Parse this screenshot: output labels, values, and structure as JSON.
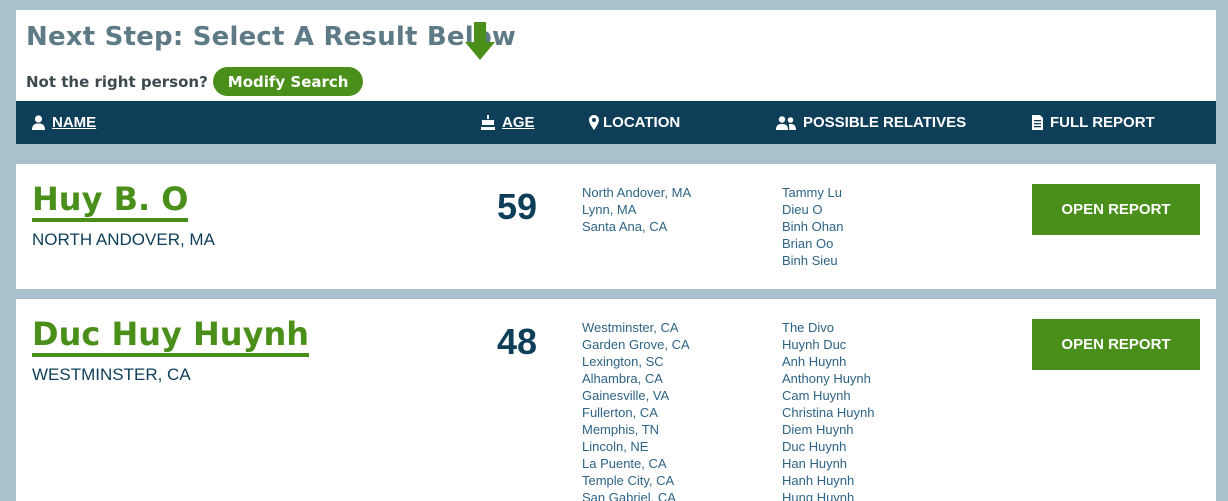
{
  "header": {
    "title": "Next Step: Select A Result Below",
    "subtext": "Not the right person?",
    "modify_label": "Modify Search"
  },
  "columns": {
    "name": "NAME",
    "age": "AGE",
    "location": "LOCATION",
    "relatives": "POSSIBLE RELATIVES",
    "report": "FULL REPORT"
  },
  "results": [
    {
      "name": "Huy B. O",
      "city": "NORTH ANDOVER, MA",
      "age": "59",
      "locations": [
        "North Andover, MA",
        "Lynn, MA",
        "Santa Ana, CA"
      ],
      "relatives": [
        "Tammy Lu",
        "Dieu O",
        "Binh Ohan",
        "Brian Oo",
        "Binh Sieu"
      ],
      "button_label": "OPEN REPORT"
    },
    {
      "name": "Duc Huy Huynh",
      "city": "WESTMINSTER, CA",
      "age": "48",
      "locations": [
        "Westminster, CA",
        "Garden Grove, CA",
        "Lexington, SC",
        "Alhambra, CA",
        "Gainesville, VA",
        "Fullerton, CA",
        "Memphis, TN",
        "Lincoln, NE",
        "La Puente, CA",
        "Temple City, CA",
        "San Gabriel, CA"
      ],
      "relatives": [
        "The Divo",
        "Huynh Duc",
        "Anh Huynh",
        "Anthony Huynh",
        "Cam Huynh",
        "Christina Huynh",
        "Diem Huynh",
        "Duc Huynh",
        "Han Huynh",
        "Hanh Huynh",
        "Hung Huynh"
      ],
      "button_label": "OPEN REPORT"
    }
  ],
  "colors": {
    "accent_green": "#4b8f1b",
    "header_navy": "#0e3e58",
    "page_bg": "#a9c1cc",
    "heading_gray": "#5e7a87"
  },
  "icons": {
    "arrow": "arrow-down-icon",
    "name": "person-icon",
    "age": "cake-icon",
    "location": "map-pin-icon",
    "relatives": "people-icon",
    "report": "document-icon"
  }
}
